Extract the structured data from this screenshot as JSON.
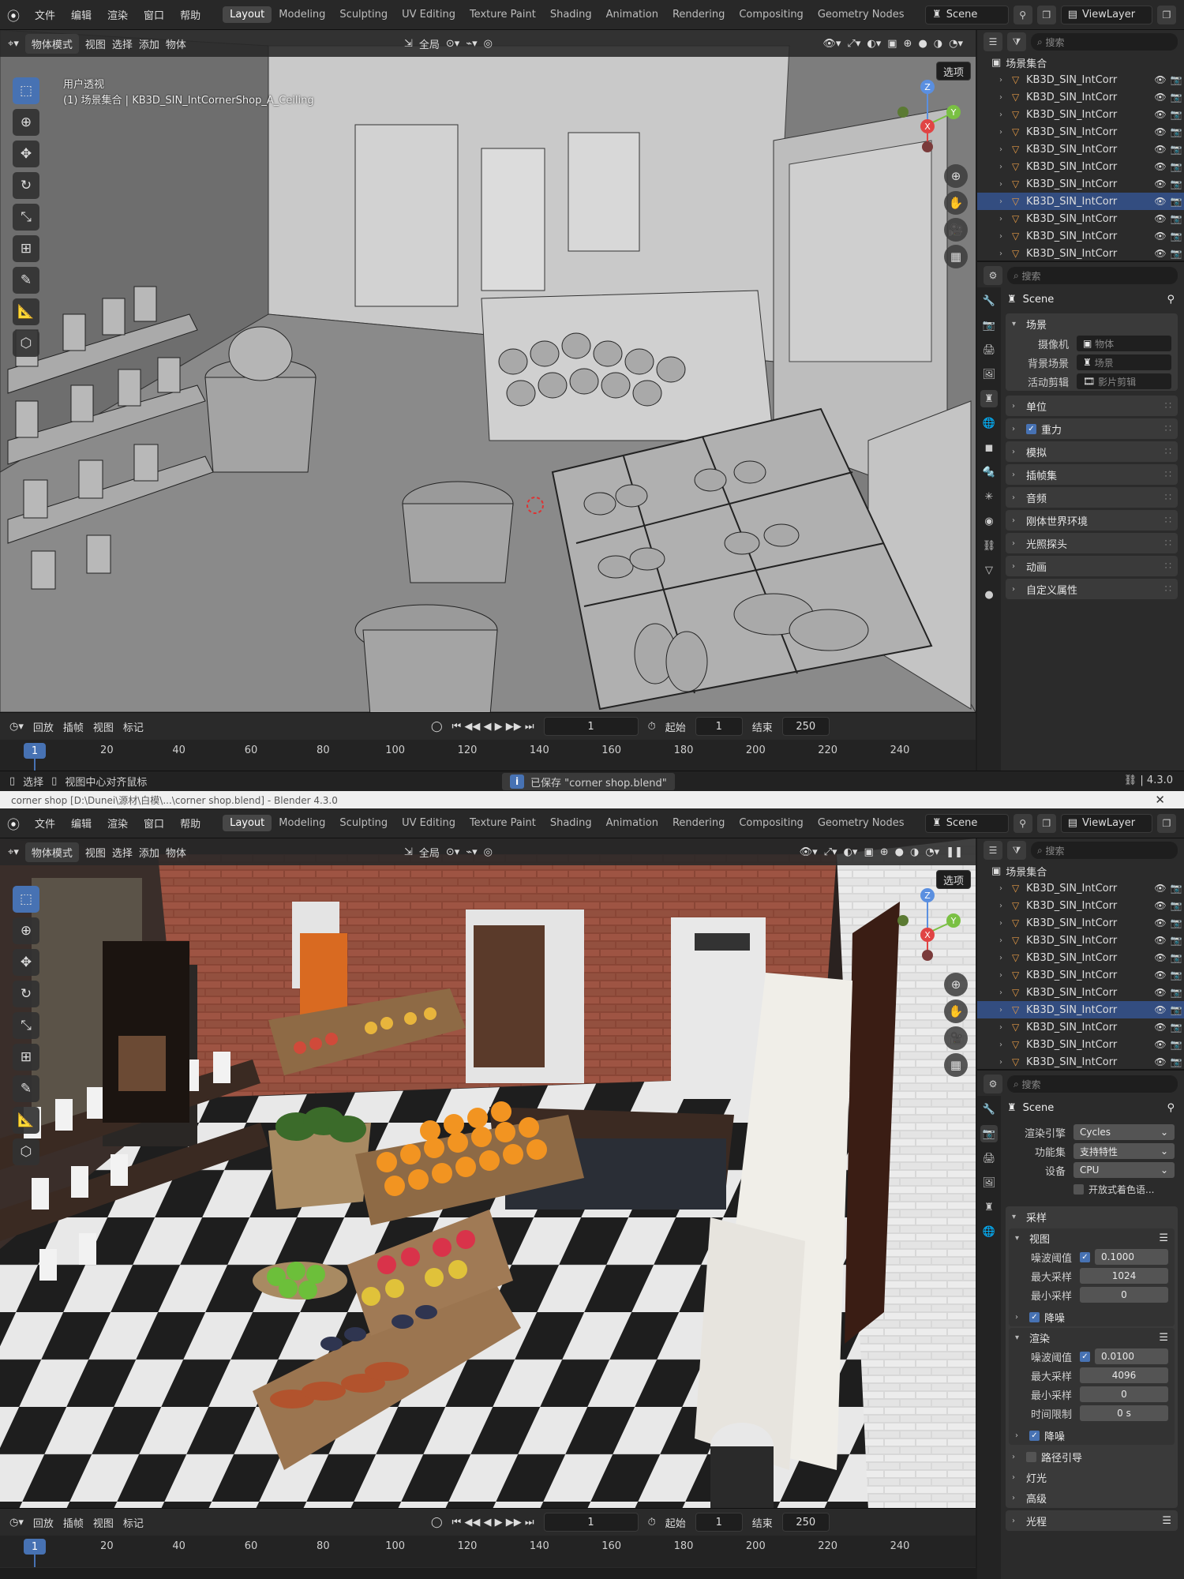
{
  "menus": [
    "文件",
    "编辑",
    "渲染",
    "窗口",
    "帮助"
  ],
  "workspaces": [
    "Layout",
    "Modeling",
    "Sculpting",
    "UV Editing",
    "Texture Paint",
    "Shading",
    "Animation",
    "Rendering",
    "Compositing",
    "Geometry Nodes"
  ],
  "active_workspace": "Layout",
  "scene_name": "Scene",
  "view_layer": "ViewLayer",
  "viewport_header": {
    "mode": "物体模式",
    "items": [
      "视图",
      "选择",
      "添加",
      "物体"
    ],
    "transform_space": "全局",
    "options": "选项"
  },
  "overlay": {
    "line1": "用户透视",
    "line2": "(1) 场景集合 | KB3D_SIN_IntCornerShop_A_Ceiling"
  },
  "gizmo_axes": {
    "z": "Z",
    "x": "X",
    "y": "Y"
  },
  "timeline": {
    "items": [
      "回放",
      "插帧",
      "视图",
      "标记"
    ],
    "current_frame": "1",
    "start_label": "起始",
    "start": "1",
    "end_label": "结束",
    "end": "250",
    "ticks": [
      "20",
      "40",
      "60",
      "80",
      "100",
      "120",
      "140",
      "160",
      "180",
      "200",
      "220",
      "240"
    ],
    "playhead": "1"
  },
  "statusbar": {
    "select": "选择",
    "center": "视图中心对齐鼠标",
    "saved": "已保存 \"corner shop.blend\"",
    "version": "4.3.0"
  },
  "titlebar2": "corner shop [D:\\Dunei\\源材\\白模\\...\\corner shop.blend] - Blender 4.3.0",
  "outliner": {
    "search_placeholder": "搜索",
    "collection": "场景集合",
    "rows": [
      "KB3D_SIN_IntCorr",
      "KB3D_SIN_IntCorr",
      "KB3D_SIN_IntCorr",
      "KB3D_SIN_IntCorr",
      "KB3D_SIN_IntCorr",
      "KB3D_SIN_IntCorr",
      "KB3D_SIN_IntCorr",
      "KB3D_SIN_IntCorr",
      "KB3D_SIN_IntCorr",
      "KB3D_SIN_IntCorr",
      "KB3D_SIN_IntCorr"
    ],
    "selected_index": 7
  },
  "props1": {
    "search_placeholder": "搜索",
    "crumb": "Scene",
    "scene_panel": "场景",
    "camera_label": "摄像机",
    "camera_value": "物体",
    "bg_label": "背景场景",
    "bg_value": "场景",
    "clip_label": "活动剪辑",
    "clip_value": "影片剪辑",
    "panels": [
      "单位",
      "重力",
      "模拟",
      "插帧集",
      "音频",
      "刚体世界环境",
      "光照探头",
      "动画",
      "自定义属性"
    ]
  },
  "props2": {
    "search_placeholder": "搜索",
    "crumb": "Scene",
    "engine_label": "渲染引擎",
    "engine": "Cycles",
    "feature_label": "功能集",
    "feature": "支持特性",
    "device_label": "设备",
    "device": "CPU",
    "osl": "开放式着色语...",
    "sampling": "采样",
    "viewport": "视图",
    "noise_label": "噪波阈值",
    "vp_noise": "0.1000",
    "max_label": "最大采样",
    "vp_max": "1024",
    "min_label": "最小采样",
    "vp_min": "0",
    "denoise": "降噪",
    "render": "渲染",
    "r_noise": "0.0100",
    "r_max": "4096",
    "r_min": "0",
    "time_label": "时间限制",
    "time": "0 s",
    "path_guiding": "路径引导",
    "lights": "灯光",
    "advanced": "高级",
    "light_paths": "光程"
  }
}
